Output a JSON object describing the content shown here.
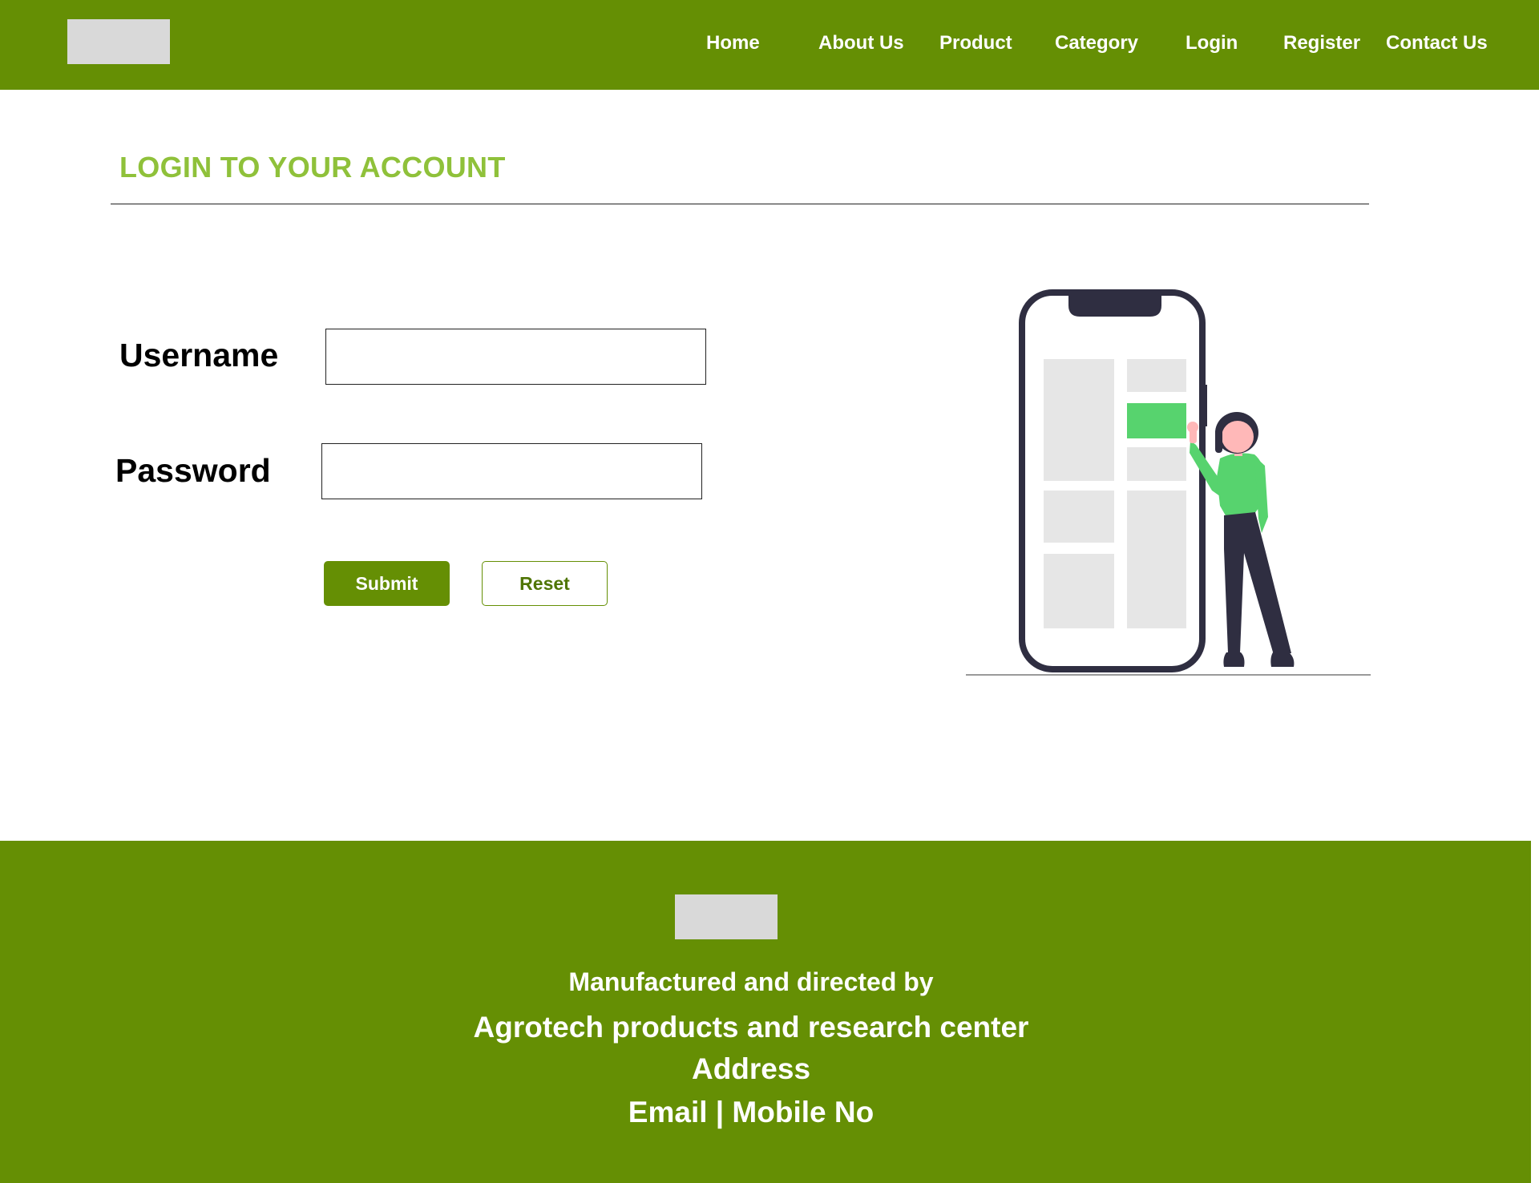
{
  "header": {
    "nav": [
      "Home",
      "About Us",
      "Product",
      "Category",
      "Login",
      "Register",
      "Contact Us"
    ]
  },
  "login": {
    "title": "LOGIN TO YOUR ACCOUNT",
    "username_label": "Username",
    "username_value": "",
    "password_label": "Password",
    "password_value": "",
    "submit_label": "Submit",
    "reset_label": "Reset"
  },
  "footer": {
    "line1": "Manufactured and directed by",
    "line2": "Agrotech products and research center",
    "line3": "Address",
    "line4": "Email | Mobile No"
  },
  "colors": {
    "brand_green": "#658f04",
    "title_green": "#8fc13a",
    "illustration_accent": "#57d36e",
    "illustration_dark": "#2f2e41"
  }
}
